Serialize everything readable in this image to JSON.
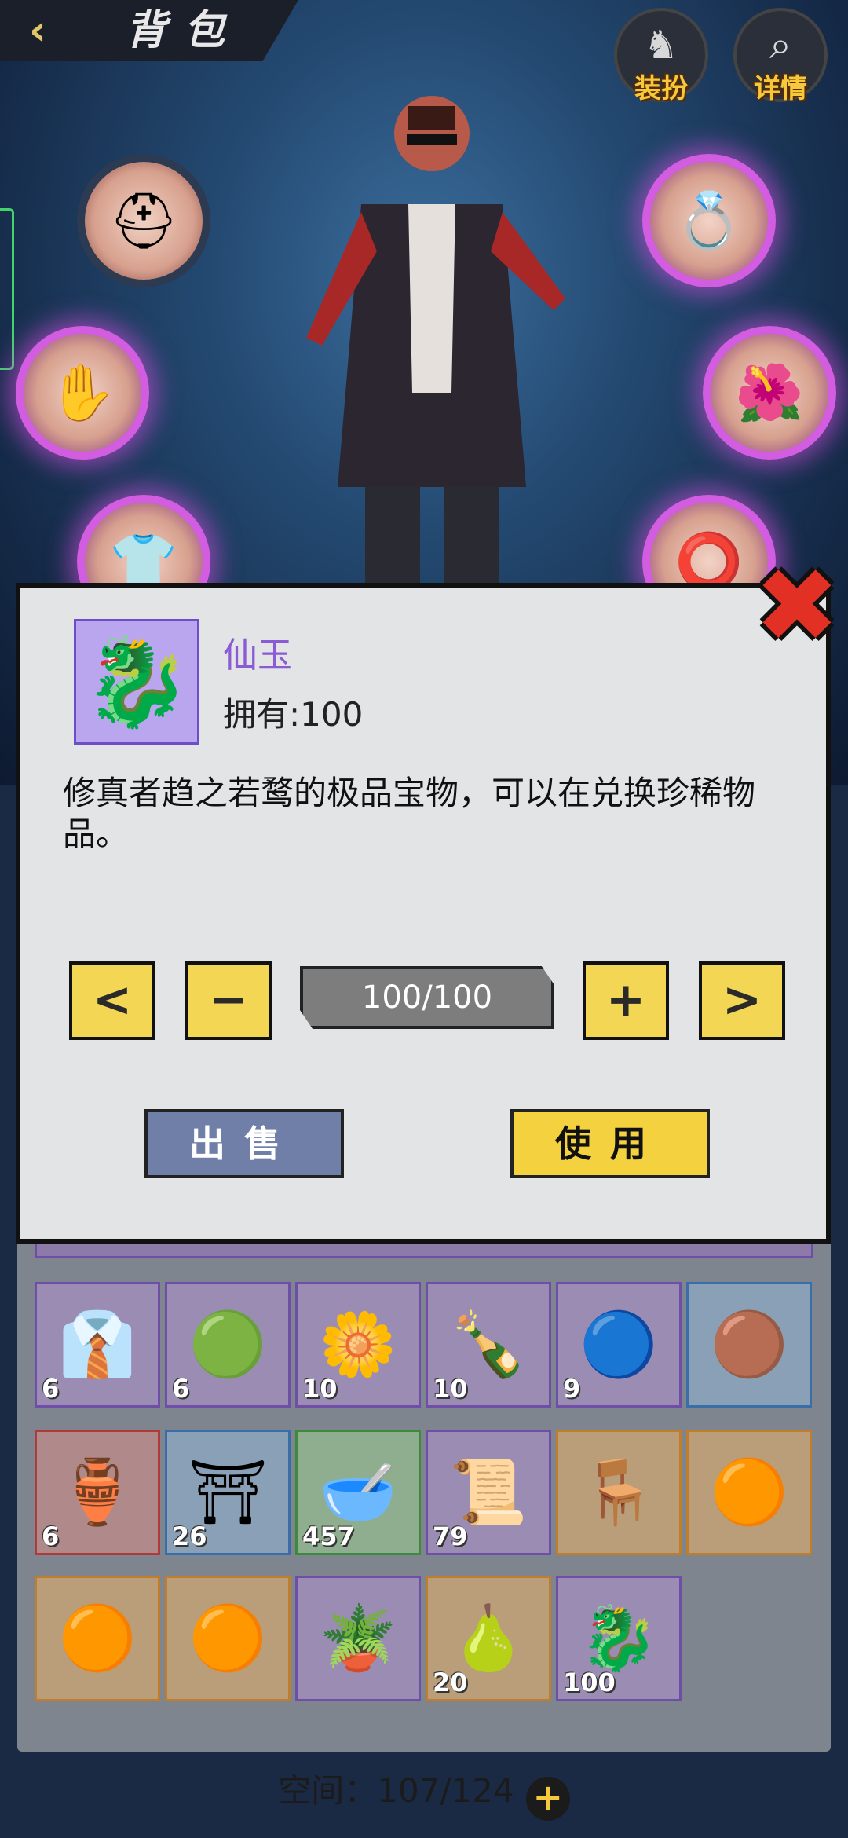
{
  "header": {
    "back_icon": "chevron-left-icon",
    "title": "背包",
    "dress_label": "装扮",
    "details_label": "详情"
  },
  "equipment_slots": {
    "left": [
      "helmet",
      "gloves",
      "armor"
    ],
    "right": [
      "ring",
      "amulet",
      "bracelet"
    ]
  },
  "dialog": {
    "item_name": "仙玉",
    "owned": "拥有:100",
    "description": "修真者趋之若鹜的极品宝物，可以在兑换珍稀物品。",
    "prev_label": "<",
    "minus_label": "−",
    "quantity": "100/100",
    "plus_label": "+",
    "next_label": ">",
    "sell_label": "出售",
    "use_label": "使用",
    "close_icon": "close-icon",
    "name_color": "#8b5bd6"
  },
  "inventory": {
    "rows": [
      [
        {
          "icon": "shirt",
          "quality": "purple",
          "count": "6"
        },
        {
          "icon": "jade-pendant",
          "quality": "purple",
          "count": "6"
        },
        {
          "icon": "marigold-flower",
          "quality": "purple",
          "count": "10"
        },
        {
          "icon": "liquor-bottle",
          "quality": "purple",
          "count": "10"
        },
        {
          "icon": "blue-orb",
          "quality": "purple",
          "count": "9"
        },
        {
          "icon": "gold-orb",
          "quality": "blue",
          "count": ""
        }
      ],
      [
        {
          "icon": "vase",
          "quality": "red",
          "count": "6"
        },
        {
          "icon": "bronze-tripod",
          "quality": "blue",
          "count": "26"
        },
        {
          "icon": "porcelain-bowl",
          "quality": "green",
          "count": "457"
        },
        {
          "icon": "scroll",
          "quality": "purple",
          "count": "79"
        },
        {
          "icon": "bronze-ding",
          "quality": "gold",
          "count": ""
        },
        {
          "icon": "cloud-orb",
          "quality": "gold",
          "count": ""
        }
      ],
      [
        {
          "icon": "cloud-orb",
          "quality": "gold",
          "count": ""
        },
        {
          "icon": "cloud-orb",
          "quality": "gold",
          "count": ""
        },
        {
          "icon": "bamboo-table",
          "quality": "purple",
          "count": ""
        },
        {
          "icon": "pear",
          "quality": "gold",
          "count": "20"
        },
        {
          "icon": "jade-dragon",
          "quality": "purple",
          "count": "100"
        }
      ]
    ]
  },
  "footer": {
    "space_label": "空间：107/124",
    "add_icon": "plus-circle-icon"
  }
}
